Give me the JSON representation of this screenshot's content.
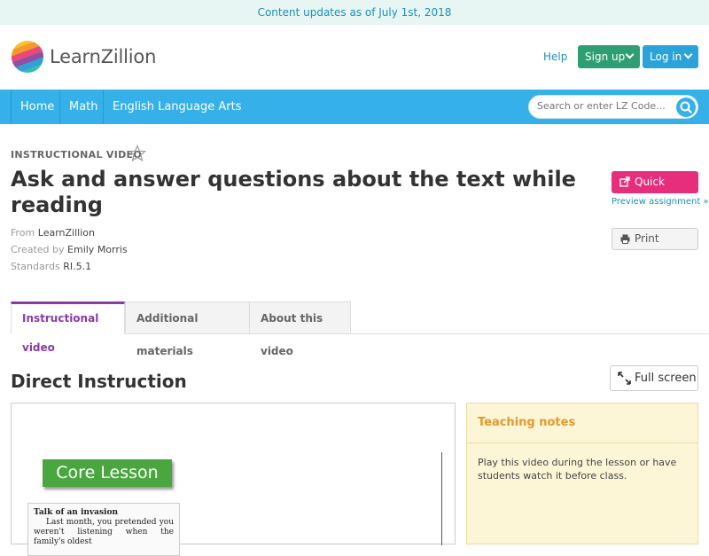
{
  "banner": {
    "text": "Content updates as of July 1st, 2018"
  },
  "header": {
    "logo_text": "LearnZillion",
    "help": "Help",
    "signup": "Sign up",
    "login": "Log in"
  },
  "nav": {
    "items": [
      "Home",
      "Math",
      "English Language Arts"
    ],
    "search_placeholder": "Search or enter LZ Code..."
  },
  "content": {
    "type_label": "INSTRUCTIONAL VIDEO",
    "title": "Ask and answer questions about the text while reading",
    "from_label": "From",
    "from_value": "LearnZillion",
    "created_label": "Created by",
    "created_value": "Emily Morris",
    "standards_label": "Standards",
    "standards_value": "RI.5.1",
    "quick_assign": "Quick assign",
    "preview_assignment": "Preview assignment »",
    "print": "Print"
  },
  "tabs": [
    "Instructional video",
    "Additional materials",
    "About this video"
  ],
  "section": {
    "title": "Direct Instruction",
    "full_screen": "Full screen"
  },
  "video": {
    "core_lesson": "Core Lesson",
    "excerpt_heading": "Talk of an invasion",
    "excerpt_text": "Last month, you pretended you weren't listening when the family's oldest"
  },
  "notes": {
    "title": "Teaching notes",
    "body": "Play this video during the lesson or have students watch it before class."
  },
  "colors": {
    "nav": "#35b0e8",
    "signup": "#2e9f73",
    "login": "#2aa3d9",
    "quick_assign": "#e62e7c",
    "active_tab": "#8a3aa8",
    "notes_title": "#e29a2b"
  }
}
